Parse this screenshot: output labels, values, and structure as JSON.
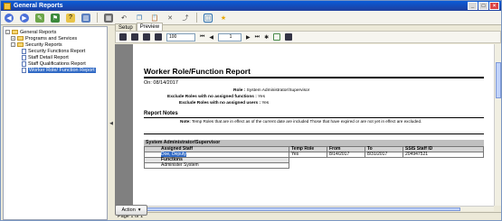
{
  "window": {
    "title": "General Reports",
    "controls": [
      "_",
      "□",
      "×"
    ]
  },
  "toolbar": {
    "icons": [
      "back-icon",
      "forward-icon",
      "edit-icon",
      "flag-icon",
      "help-icon",
      "chart-icon",
      "grid-icon",
      "undo-icon",
      "copy-icon",
      "paste-icon",
      "delete-icon",
      "link-icon",
      "view-icon",
      "star-icon"
    ]
  },
  "tree": {
    "items": [
      {
        "label": "General Reports",
        "level": 0,
        "type": "folder",
        "expander": "-"
      },
      {
        "label": "Programs and Services",
        "level": 1,
        "type": "folder",
        "expander": "+"
      },
      {
        "label": "Security Reports",
        "level": 1,
        "type": "folder",
        "expander": "-"
      },
      {
        "label": "Security Functions Report",
        "level": 2,
        "type": "doc"
      },
      {
        "label": "Staff Detail Report",
        "level": 2,
        "type": "doc"
      },
      {
        "label": "Staff Qualifications Report",
        "level": 2,
        "type": "doc"
      },
      {
        "label": "Worker Role/ Function Report",
        "level": 2,
        "type": "doc",
        "selected": true
      }
    ]
  },
  "tabs": [
    "Setup",
    "Preview"
  ],
  "viewer_toolbar": {
    "zoom": "100",
    "page": "1"
  },
  "report": {
    "title": "Worker Role/Function Report",
    "date": "On: 08/14/2017",
    "params": [
      {
        "label": "Role :",
        "value": "System Administrator/Supervisor"
      },
      {
        "label": "Exclude Roles with no assigned functions :",
        "value": "Yes"
      },
      {
        "label": "Exclude Roles with no assigned users :",
        "value": "Yes"
      }
    ],
    "notes_heading": "Report Notes",
    "note_label": "Note:",
    "note_text": "Temp Roles that are in effect as of the current date are included Those that have expired or are not yet in effect are excluded.",
    "group_header": "System Administrator/Supervisor",
    "columns": [
      "Assigned Staff",
      "Temp Role",
      "From",
      "To",
      "SSIS Staff ID"
    ],
    "row": [
      "Doe, Deputy",
      "Yes",
      "8/14/2017",
      "8/31/2017",
      "204947521"
    ],
    "functions_label": "Functions",
    "functions": [
      "Administer System"
    ]
  },
  "status": {
    "page": "Page 1 of 1"
  },
  "action_button": {
    "label": "Action",
    "arrow": "▾"
  }
}
